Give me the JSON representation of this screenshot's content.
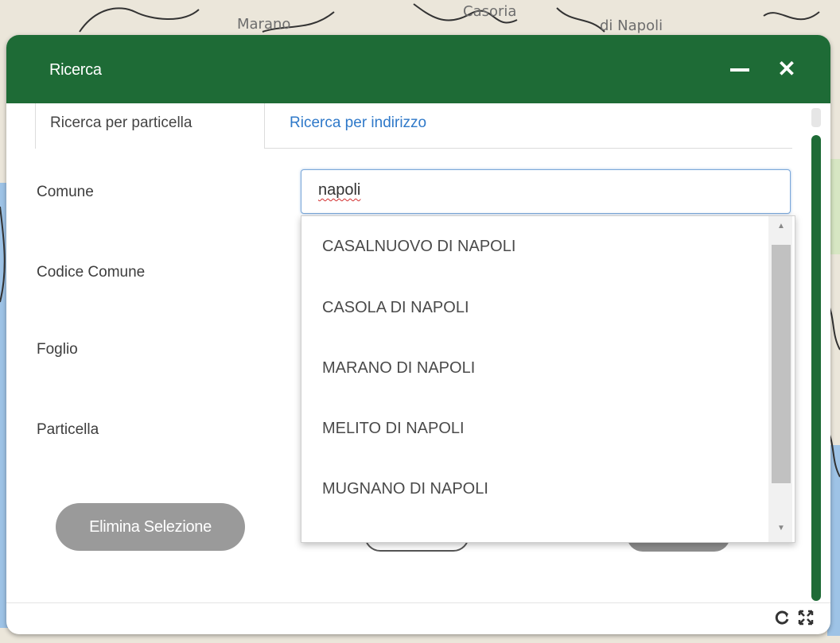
{
  "map": {
    "labels": [
      "Marano",
      "Casoria",
      "di Napoli"
    ]
  },
  "dialog": {
    "title": "Ricerca",
    "minimize_icon": "minus-icon",
    "close_icon": "close-icon",
    "close_glyph": "✕",
    "accent_color": "#1e6b36"
  },
  "tabs": {
    "particella": "Ricerca per particella",
    "indirizzo": "Ricerca per indirizzo"
  },
  "form": {
    "comune_label": "Comune",
    "comune_value": "napoli",
    "codice_label": "Codice Comune",
    "foglio_label": "Foglio",
    "particella_label": "Particella",
    "elimina_label": "Elimina Selezione"
  },
  "dropdown": {
    "options": [
      "CASALNUOVO DI NAPOLI",
      "CASOLA DI NAPOLI",
      "MARANO DI NAPOLI",
      "MELITO DI NAPOLI",
      "MUGNANO DI NAPOLI"
    ]
  },
  "footer": {
    "refresh_icon": "refresh-icon",
    "expand_icon": "expand-icon"
  }
}
